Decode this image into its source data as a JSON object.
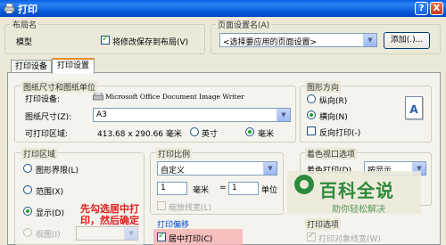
{
  "window": {
    "title": "打印",
    "help_label": "?",
    "close_label": "X"
  },
  "layout_group": {
    "title": "布局名",
    "name": "模型",
    "save_to_layout_label": "将修改保存到布局(V)",
    "save_to_layout_checked": true
  },
  "page_setup_group": {
    "title": "页面设置名(A)",
    "selected": "<选择要应用的页面设置>",
    "add_button": "添加(.)..."
  },
  "tabs": [
    {
      "label": "打印设备"
    },
    {
      "label": "打印设置",
      "active": true
    }
  ],
  "paper_group": {
    "title": "图纸尺寸和图纸单位",
    "device_label": "打印设备:",
    "device_value": "Microsoft Office Document Image Writer",
    "size_label": "图纸尺寸(Z):",
    "size_value": "A3",
    "area_label": "可打印区域:",
    "area_value": "413.68 x 290.66 毫米",
    "unit_inch": "英寸",
    "unit_mm": "毫米",
    "unit_selected": "mm"
  },
  "orientation_group": {
    "title": "图形方向",
    "portrait": "纵向(R)",
    "landscape": "横向(N)",
    "reverse": "反向打印(-)",
    "selected": "landscape",
    "preview_letter": "A"
  },
  "plot_area_group": {
    "title": "打印区域",
    "options": [
      "图形界限(L)",
      "范围(X)",
      "显示(D)",
      "视图(I)"
    ],
    "selected_index": 2
  },
  "scale_group": {
    "title": "打印比例",
    "scale_value": "自定义",
    "num_value": "1",
    "num_unit": "毫米",
    "equals": "=",
    "den_value": "1",
    "den_unit": "单位",
    "lineweight_label": "缩放线宽(L)"
  },
  "offset_group": {
    "title": "打印偏移",
    "center_label": "居中打印(C)",
    "center_checked": true
  },
  "shade_group": {
    "title": "着色视口选项",
    "shade_label": "着色打印(D)",
    "shade_value": "按显示"
  },
  "options_group": {
    "title": "打印选项",
    "lineweight_label": "打印对象线宽(W)"
  },
  "annotation": {
    "line1": "先勾选居中打",
    "line2": "印，然后确定"
  },
  "watermark": {
    "title": "百科全说",
    "subtitle": "助你轻松解决"
  }
}
